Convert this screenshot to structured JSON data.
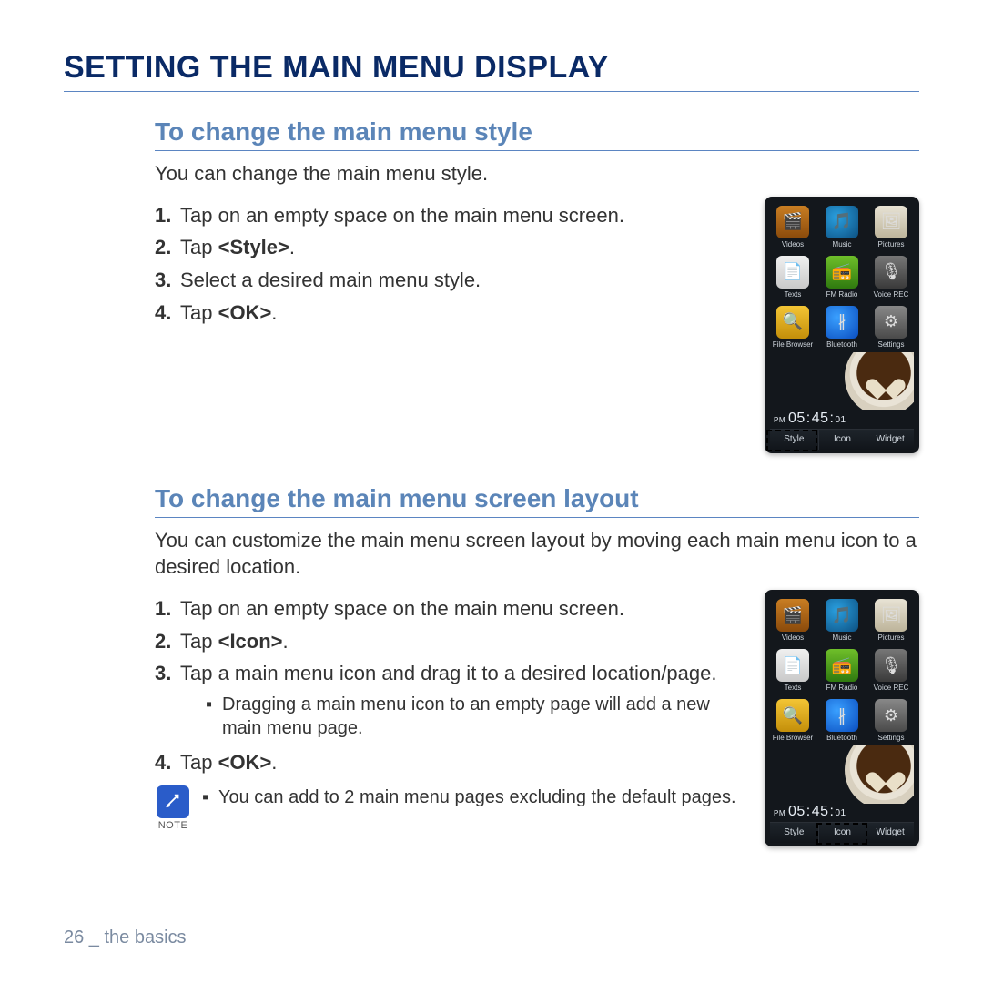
{
  "page": {
    "title": "SETTING THE MAIN MENU DISPLAY",
    "footer_page": "26",
    "footer_sep": " _ ",
    "footer_section": "the basics"
  },
  "section1": {
    "heading": "To change the main menu style",
    "intro": "You can change the main menu style.",
    "steps": {
      "s1": "Tap on an empty space on the main menu screen.",
      "s2_pre": "Tap ",
      "s2_b": "<Style>",
      "s2_post": ".",
      "s3": "Select a desired main menu style.",
      "s4_pre": "Tap ",
      "s4_b": "<OK>",
      "s4_post": "."
    }
  },
  "section2": {
    "heading": "To change the main menu screen layout",
    "intro": "You can customize the main menu screen layout by moving each main menu icon to a desired location.",
    "steps": {
      "s1": "Tap on an empty space on the main menu screen.",
      "s2_pre": "Tap ",
      "s2_b": "<Icon>",
      "s2_post": ".",
      "s3": "Tap a main menu icon and drag it to a desired location/page.",
      "s3_sub": "Dragging a main menu icon to an empty page will add a new main menu page.",
      "s4_pre": "Tap ",
      "s4_b": "<OK>",
      "s4_post": "."
    },
    "note_label": "NOTE",
    "note_text": "You can add to 2 main menu pages excluding the default pages."
  },
  "device": {
    "icons": {
      "videos": {
        "label": "Videos",
        "glyph": "🎬"
      },
      "music": {
        "label": "Music",
        "glyph": "🎵"
      },
      "pictures": {
        "label": "Pictures",
        "glyph": "🖼"
      },
      "texts": {
        "label": "Texts",
        "glyph": "📄"
      },
      "fmradio": {
        "label": "FM Radio",
        "glyph": "📻"
      },
      "voice": {
        "label": "Voice REC",
        "glyph": "🎙"
      },
      "file": {
        "label": "File Browser",
        "glyph": "🔍"
      },
      "bt": {
        "label": "Bluetooth",
        "glyph": "∦"
      },
      "settings": {
        "label": "Settings",
        "glyph": "⚙"
      }
    },
    "clock": {
      "ampm": "PM",
      "hh": "05",
      "mm": "45",
      "ss": "01"
    },
    "tabs": {
      "style": "Style",
      "icon": "Icon",
      "widget": "Widget"
    }
  }
}
